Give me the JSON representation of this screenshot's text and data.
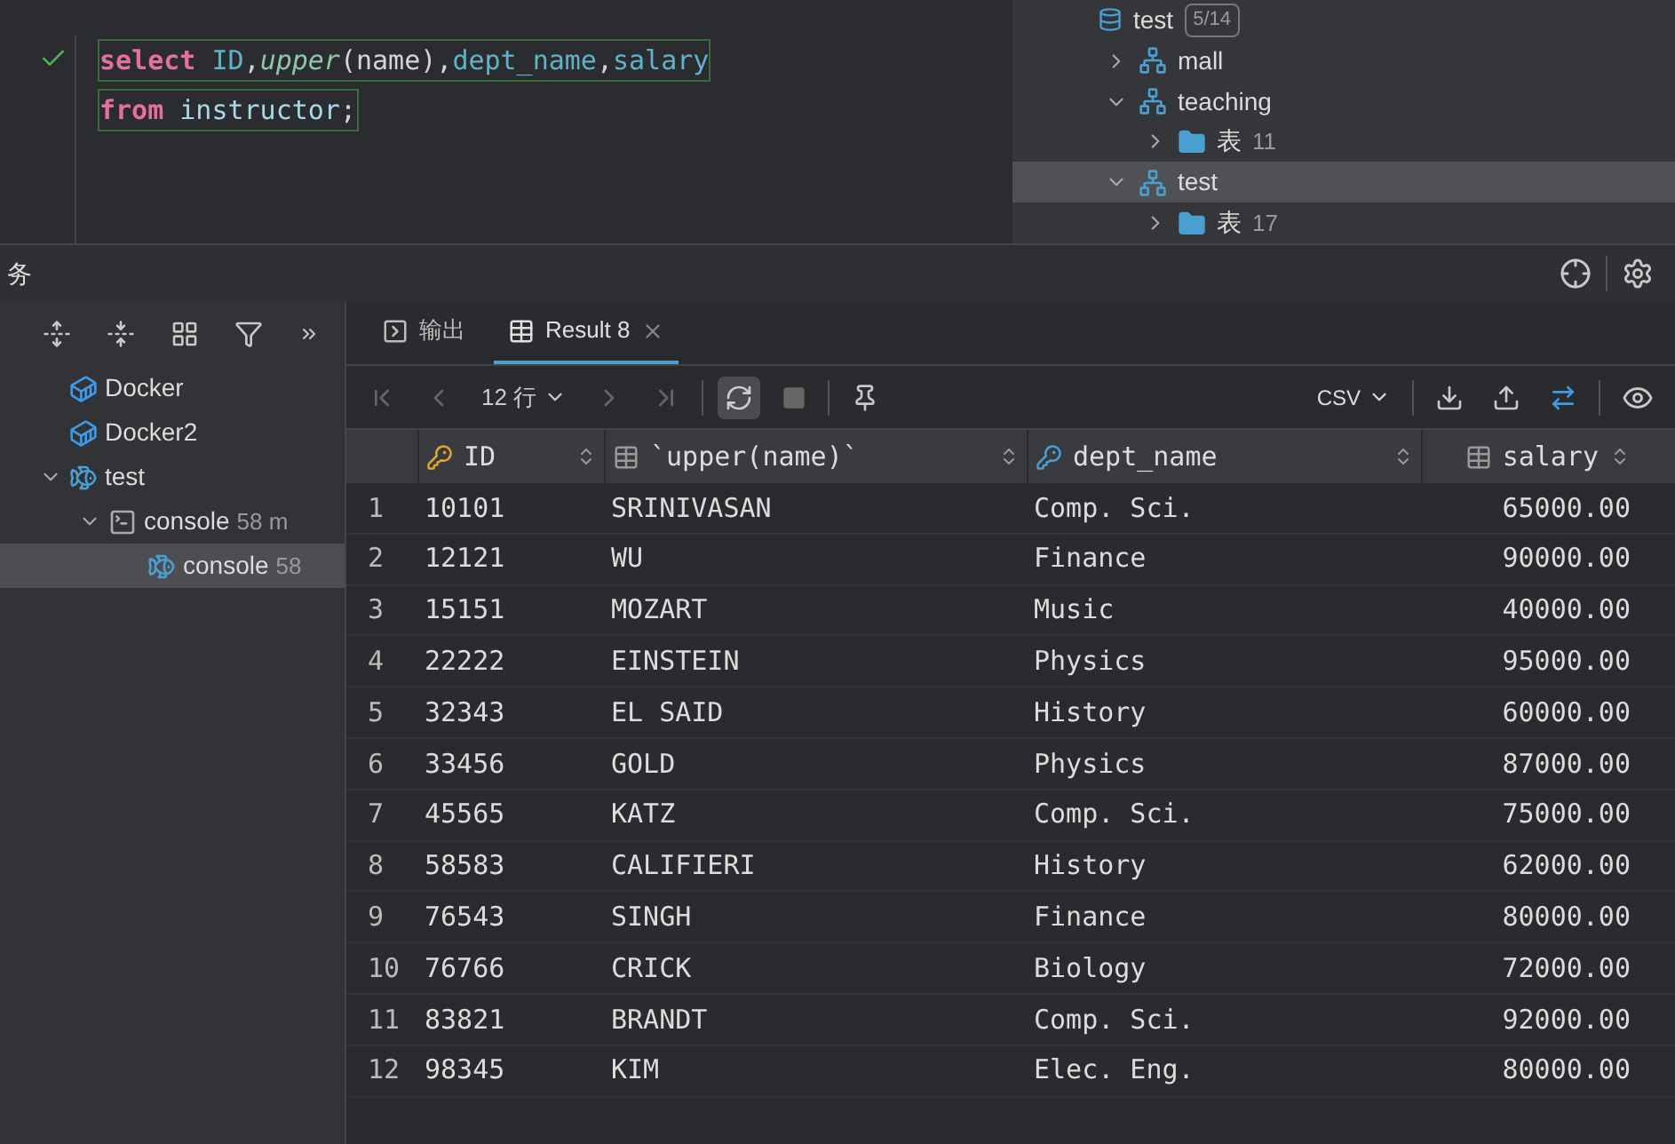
{
  "editor": {
    "lines": [
      [
        {
          "kind": "keyword",
          "text": "select "
        },
        {
          "kind": "column",
          "text": "ID"
        },
        {
          "kind": "plain",
          "text": ","
        },
        {
          "kind": "function",
          "text": "upper"
        },
        {
          "kind": "plain",
          "text": "(name),"
        },
        {
          "kind": "column",
          "text": "dept_name"
        },
        {
          "kind": "plain",
          "text": ","
        },
        {
          "kind": "column",
          "text": "salary"
        }
      ],
      [
        {
          "kind": "keyword",
          "text": "from "
        },
        {
          "kind": "table",
          "text": "instructor"
        },
        {
          "kind": "plain",
          "text": ";"
        }
      ]
    ]
  },
  "db_tree": {
    "items": [
      {
        "kind": "connection",
        "label": "test",
        "badge": "5/14",
        "selected": false,
        "children": [
          {
            "kind": "schema",
            "label": "mall",
            "expanded": false,
            "selected": false
          },
          {
            "kind": "schema",
            "label": "teaching",
            "expanded": true,
            "selected": false,
            "children": [
              {
                "kind": "folder",
                "label": "表",
                "count": "11",
                "expanded": false,
                "selected": false
              }
            ]
          },
          {
            "kind": "schema",
            "label": "test",
            "expanded": true,
            "selected": true,
            "children": [
              {
                "kind": "folder",
                "label": "表",
                "count": "17",
                "expanded": false,
                "selected": false
              }
            ]
          }
        ]
      }
    ]
  },
  "services": {
    "title": "务",
    "items": [
      {
        "kind": "docker",
        "label": "Docker",
        "selected": false
      },
      {
        "kind": "docker",
        "label": "Docker2",
        "selected": false
      },
      {
        "kind": "mysql",
        "label": "test",
        "expanded": true,
        "selected": false,
        "children": [
          {
            "kind": "console",
            "label": "console",
            "detail": "58 m",
            "expanded": true,
            "selected": false,
            "children": [
              {
                "kind": "mysql",
                "label": "console",
                "detail": "58",
                "selected": true
              }
            ]
          }
        ]
      }
    ]
  },
  "results": {
    "tabs": [
      {
        "kind": "output",
        "label": "输出",
        "selected": false
      },
      {
        "kind": "table",
        "label": "Result 8",
        "selected": true
      }
    ],
    "row_count": "12 行",
    "export_format": "CSV",
    "columns": [
      {
        "kind": "key",
        "label": "ID"
      },
      {
        "kind": "plain",
        "label": "`upper(name)`"
      },
      {
        "kind": "index",
        "label": "dept_name"
      },
      {
        "kind": "plain",
        "label": "salary"
      }
    ],
    "rows": [
      {
        "n": "1",
        "cells": [
          "10101",
          "SRINIVASAN",
          "Comp. Sci.",
          "65000.00"
        ]
      },
      {
        "n": "2",
        "cells": [
          "12121",
          "WU",
          "Finance",
          "90000.00"
        ]
      },
      {
        "n": "3",
        "cells": [
          "15151",
          "MOZART",
          "Music",
          "40000.00"
        ]
      },
      {
        "n": "4",
        "cells": [
          "22222",
          "EINSTEIN",
          "Physics",
          "95000.00"
        ]
      },
      {
        "n": "5",
        "cells": [
          "32343",
          "EL SAID",
          "History",
          "60000.00"
        ]
      },
      {
        "n": "6",
        "cells": [
          "33456",
          "GOLD",
          "Physics",
          "87000.00"
        ]
      },
      {
        "n": "7",
        "cells": [
          "45565",
          "KATZ",
          "Comp. Sci.",
          "75000.00"
        ]
      },
      {
        "n": "8",
        "cells": [
          "58583",
          "CALIFIERI",
          "History",
          "62000.00"
        ]
      },
      {
        "n": "9",
        "cells": [
          "76543",
          "SINGH",
          "Finance",
          "80000.00"
        ]
      },
      {
        "n": "10",
        "cells": [
          "76766",
          "CRICK",
          "Biology",
          "72000.00"
        ]
      },
      {
        "n": "11",
        "cells": [
          "83821",
          "BRANDT",
          "Comp. Sci.",
          "92000.00"
        ]
      },
      {
        "n": "12",
        "cells": [
          "98345",
          "KIM",
          "Elec. Eng.",
          "80000.00"
        ]
      }
    ]
  }
}
